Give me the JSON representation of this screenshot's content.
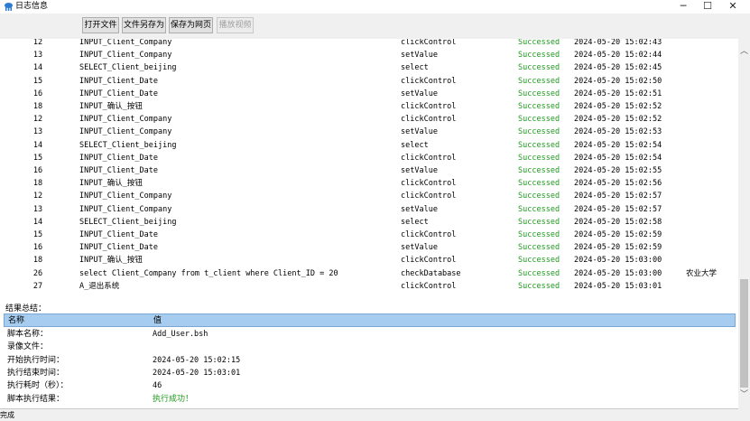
{
  "window": {
    "title": "日志信息",
    "icon": "app-logo-icon",
    "controls": {
      "minimize": "─",
      "maximize": "☐",
      "close": "✕"
    }
  },
  "toolbar": {
    "open_file": "打开文件",
    "save_file_as": "文件另存为",
    "save_as_webpage": "保存为网页",
    "play_video": "播放视频"
  },
  "log": {
    "success_color": "#1e9a1e",
    "rows": [
      {
        "id": "12",
        "object": "INPUT_Client_Company",
        "action": "clickControl",
        "result": "Successed",
        "time": "2024-05-20 15:02:43",
        "extra": ""
      },
      {
        "id": "13",
        "object": "INPUT_Client_Company",
        "action": "setValue",
        "result": "Successed",
        "time": "2024-05-20 15:02:44",
        "extra": ""
      },
      {
        "id": "14",
        "object": "SELECT_Client_beijing",
        "action": "select",
        "result": "Successed",
        "time": "2024-05-20 15:02:45",
        "extra": ""
      },
      {
        "id": "15",
        "object": "INPUT_Client_Date",
        "action": "clickControl",
        "result": "Successed",
        "time": "2024-05-20 15:02:50",
        "extra": ""
      },
      {
        "id": "16",
        "object": "INPUT_Client_Date",
        "action": "setValue",
        "result": "Successed",
        "time": "2024-05-20 15:02:51",
        "extra": ""
      },
      {
        "id": "18",
        "object": "INPUT_确认_按钮",
        "action": "clickControl",
        "result": "Successed",
        "time": "2024-05-20 15:02:52",
        "extra": ""
      },
      {
        "id": "12",
        "object": "INPUT_Client_Company",
        "action": "clickControl",
        "result": "Successed",
        "time": "2024-05-20 15:02:52",
        "extra": ""
      },
      {
        "id": "13",
        "object": "INPUT_Client_Company",
        "action": "setValue",
        "result": "Successed",
        "time": "2024-05-20 15:02:53",
        "extra": ""
      },
      {
        "id": "14",
        "object": "SELECT_Client_beijing",
        "action": "select",
        "result": "Successed",
        "time": "2024-05-20 15:02:54",
        "extra": ""
      },
      {
        "id": "15",
        "object": "INPUT_Client_Date",
        "action": "clickControl",
        "result": "Successed",
        "time": "2024-05-20 15:02:54",
        "extra": ""
      },
      {
        "id": "16",
        "object": "INPUT_Client_Date",
        "action": "setValue",
        "result": "Successed",
        "time": "2024-05-20 15:02:55",
        "extra": ""
      },
      {
        "id": "18",
        "object": "INPUT_确认_按钮",
        "action": "clickControl",
        "result": "Successed",
        "time": "2024-05-20 15:02:56",
        "extra": ""
      },
      {
        "id": "12",
        "object": "INPUT_Client_Company",
        "action": "clickControl",
        "result": "Successed",
        "time": "2024-05-20 15:02:57",
        "extra": ""
      },
      {
        "id": "13",
        "object": "INPUT_Client_Company",
        "action": "setValue",
        "result": "Successed",
        "time": "2024-05-20 15:02:57",
        "extra": ""
      },
      {
        "id": "14",
        "object": "SELECT_Client_beijing",
        "action": "select",
        "result": "Successed",
        "time": "2024-05-20 15:02:58",
        "extra": ""
      },
      {
        "id": "15",
        "object": "INPUT_Client_Date",
        "action": "clickControl",
        "result": "Successed",
        "time": "2024-05-20 15:02:59",
        "extra": ""
      },
      {
        "id": "16",
        "object": "INPUT_Client_Date",
        "action": "setValue",
        "result": "Successed",
        "time": "2024-05-20 15:02:59",
        "extra": ""
      },
      {
        "id": "18",
        "object": "INPUT_确认_按钮",
        "action": "clickControl",
        "result": "Successed",
        "time": "2024-05-20 15:03:00",
        "extra": ""
      },
      {
        "id": "26",
        "object": "select Client_Company from t_client where Client_ID = 20",
        "action": "checkDatabase",
        "result": "Successed",
        "time": "2024-05-20 15:03:00",
        "extra": "农业大学"
      },
      {
        "id": "27",
        "object": "A_退出系统",
        "action": "clickControl",
        "result": "Successed",
        "time": "2024-05-20 15:03:01",
        "extra": ""
      }
    ]
  },
  "summary": {
    "title": "结果总结：",
    "header": {
      "name": "名称",
      "value": "值"
    },
    "header_color": "#a6cdf0",
    "rows": [
      {
        "key": "脚本名称：",
        "value": "Add_User.bsh",
        "success": false
      },
      {
        "key": "录像文件：",
        "value": "",
        "success": false
      },
      {
        "key": "开始执行时间：",
        "value": "2024-05-20 15:02:15",
        "success": false
      },
      {
        "key": "执行结束时间：",
        "value": "2024-05-20 15:03:01",
        "success": false
      },
      {
        "key": "执行耗时（秒）：",
        "value": "46",
        "success": false
      },
      {
        "key": "脚本执行结果：",
        "value": "执行成功！",
        "success": true
      }
    ]
  },
  "scrollbar": {
    "up": "︿",
    "down": "﹀"
  },
  "status": {
    "text": "完成"
  }
}
